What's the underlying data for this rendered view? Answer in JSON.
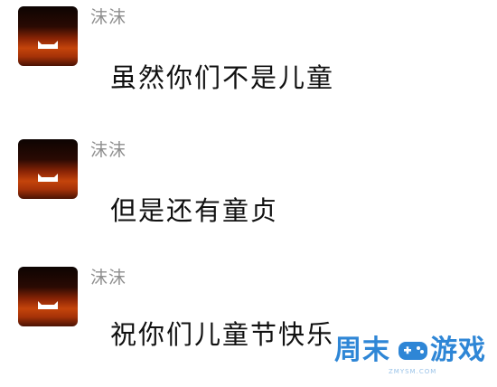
{
  "messages": [
    {
      "sender": "沫沫",
      "text": "虽然你们不是儿童"
    },
    {
      "sender": "沫沫",
      "text": "但是还有童贞"
    },
    {
      "sender": "沫沫",
      "text": "祝你们儿童节快乐"
    }
  ],
  "watermark": {
    "left_text": "周末",
    "right_text": "游戏",
    "sub_text": "ZMYSM.COM",
    "icon": "gamepad-icon"
  },
  "colors": {
    "sender": "#8e8e8e",
    "message_text": "#111111",
    "watermark": "#2e86d6"
  }
}
